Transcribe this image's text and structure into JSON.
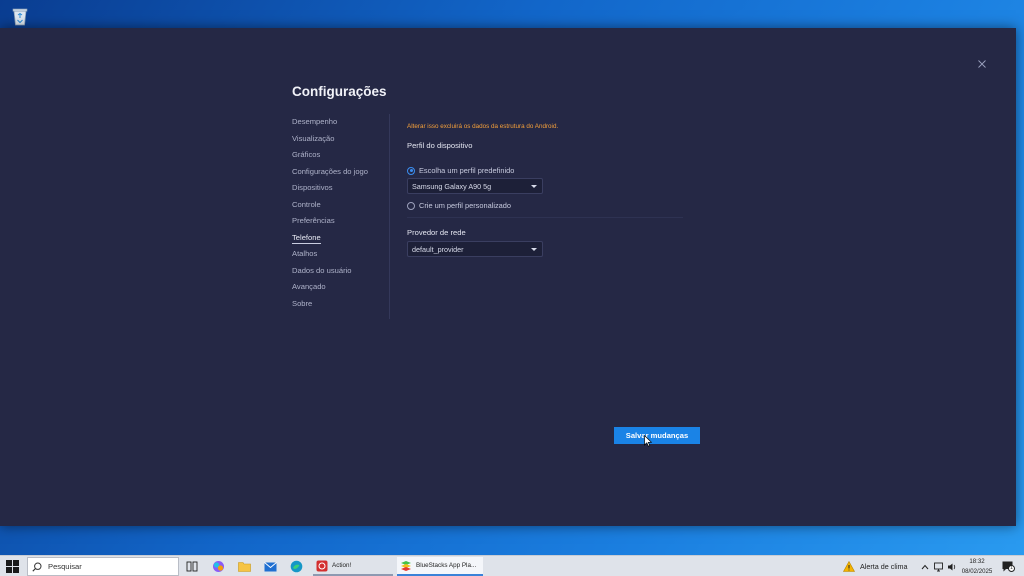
{
  "dialog": {
    "title": "Configurações",
    "nav": [
      {
        "label": "Desempenho"
      },
      {
        "label": "Visualização"
      },
      {
        "label": "Gráficos"
      },
      {
        "label": "Configurações do jogo"
      },
      {
        "label": "Dispositivos"
      },
      {
        "label": "Controle"
      },
      {
        "label": "Preferências"
      },
      {
        "label": "Telefone",
        "active": true
      },
      {
        "label": "Atalhos"
      },
      {
        "label": "Dados do usuário"
      },
      {
        "label": "Avançado"
      },
      {
        "label": "Sobre"
      }
    ],
    "device_profile": {
      "heading": "Perfil do dispositivo",
      "warning": "Alterar isso excluirá os dados da estrutura do Android.",
      "option_predefined": "Escolha um perfil predefinido",
      "selected_profile": "Samsung Galaxy A90 5g",
      "option_custom": "Crie um perfil personalizado"
    },
    "network": {
      "heading": "Provedor de rede",
      "selected_provider": "default_provider"
    },
    "save_label": "Salvar mudanças"
  },
  "taskbar": {
    "search_placeholder": "Pesquisar",
    "apps": [
      {
        "label": "Action!"
      },
      {
        "label": "BlueStacks App Pla..."
      }
    ],
    "weather_label": "Alerta de clima",
    "time": "18:32",
    "date": "08/02/2025",
    "notification_count": "1"
  },
  "colors": {
    "accent": "#1a83e6",
    "dialog_bg": "#252845",
    "warning": "#f5a03a"
  }
}
